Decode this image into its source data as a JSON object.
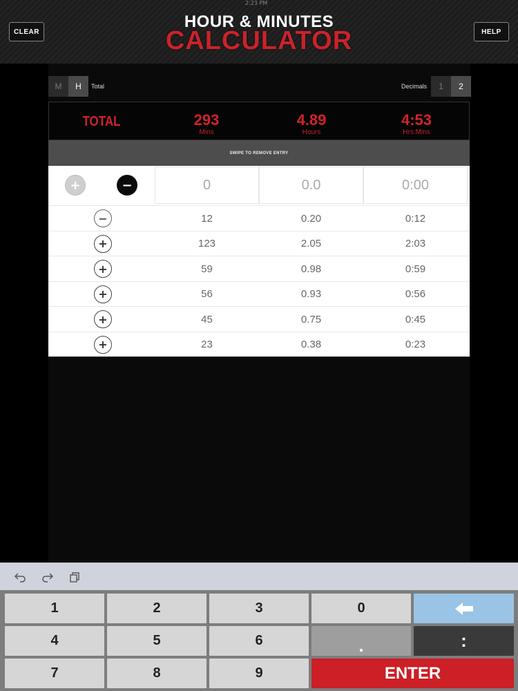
{
  "header": {
    "status_time": "2:23 PM",
    "title_top": "HOUR & MINUTES",
    "title_bottom": "CALCULATOR",
    "clear_label": "CLEAR",
    "help_label": "HELP"
  },
  "mode": {
    "options": [
      "M",
      "H"
    ],
    "selected": "H",
    "total_label": "Total"
  },
  "decimals": {
    "label": "Decimals",
    "options": [
      "1",
      "2"
    ],
    "selected": "2"
  },
  "totals": {
    "label": "TOTAL",
    "mins": "293",
    "mins_unit": "Mins",
    "hours": "4.89",
    "hours_unit": "Hours",
    "hrsmins": "4:53",
    "hrsmins_unit": "Hrs:Mins"
  },
  "swipe_hint": "SWIPE TO REMOVE ENTRY",
  "entry": {
    "mins_placeholder": "0",
    "hours_placeholder": "0.0",
    "hrsmins_placeholder": "0:00"
  },
  "rows": [
    {
      "sign": "−",
      "mins": "12",
      "hours": "0.20",
      "hrsmins": "0:12"
    },
    {
      "sign": "+",
      "mins": "123",
      "hours": "2.05",
      "hrsmins": "2:03"
    },
    {
      "sign": "+",
      "mins": "59",
      "hours": "0.98",
      "hrsmins": "0:59"
    },
    {
      "sign": "+",
      "mins": "56",
      "hours": "0.93",
      "hrsmins": "0:56"
    },
    {
      "sign": "+",
      "mins": "45",
      "hours": "0.75",
      "hrsmins": "0:45"
    },
    {
      "sign": "+",
      "mins": "23",
      "hours": "0.38",
      "hrsmins": "0:23"
    }
  ],
  "toolbar": {
    "icons": [
      "undo-icon",
      "redo-icon",
      "paste-icon"
    ]
  },
  "keypad": {
    "k1": "1",
    "k2": "2",
    "k3": "3",
    "k0": "0",
    "k4": "4",
    "k5": "5",
    "k6": "6",
    "kdot": ".",
    "kcolon": ":",
    "k7": "7",
    "k8": "8",
    "k9": "9",
    "enter": "ENTER"
  },
  "colors": {
    "accent_red": "#d0232b",
    "backspace_blue": "#99c4e6"
  }
}
